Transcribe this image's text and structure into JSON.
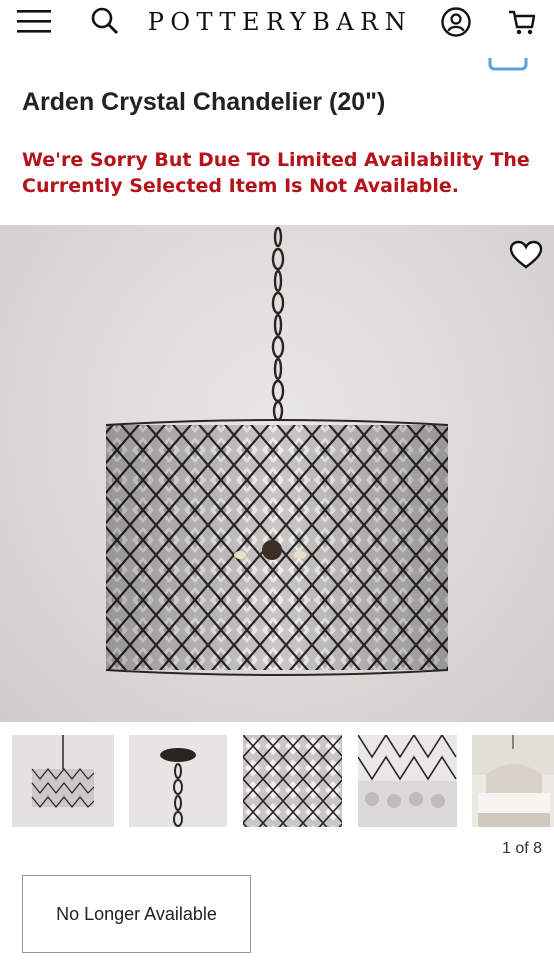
{
  "header": {
    "brand": "POTTERYBARN",
    "icons": [
      "hamburger-menu-icon",
      "search-icon",
      "account-icon",
      "cart-icon"
    ]
  },
  "product": {
    "title": "Arden Crystal Chandelier (20\")",
    "availability_message": "We're Sorry But Due To Limited Availability The Currently Selected Item Is Not Available."
  },
  "gallery": {
    "counter": "1 of 8",
    "current_index": 1,
    "total": 8,
    "visible_thumbnails": [
      "chandelier-front",
      "canopy-chain",
      "crystal-detail",
      "lattice-detail",
      "bedroom-scene"
    ]
  },
  "actions": {
    "status_button": "No Longer Available"
  },
  "colors": {
    "error_red": "#b5121b",
    "text": "#222222",
    "selected_outline": "#111111"
  }
}
